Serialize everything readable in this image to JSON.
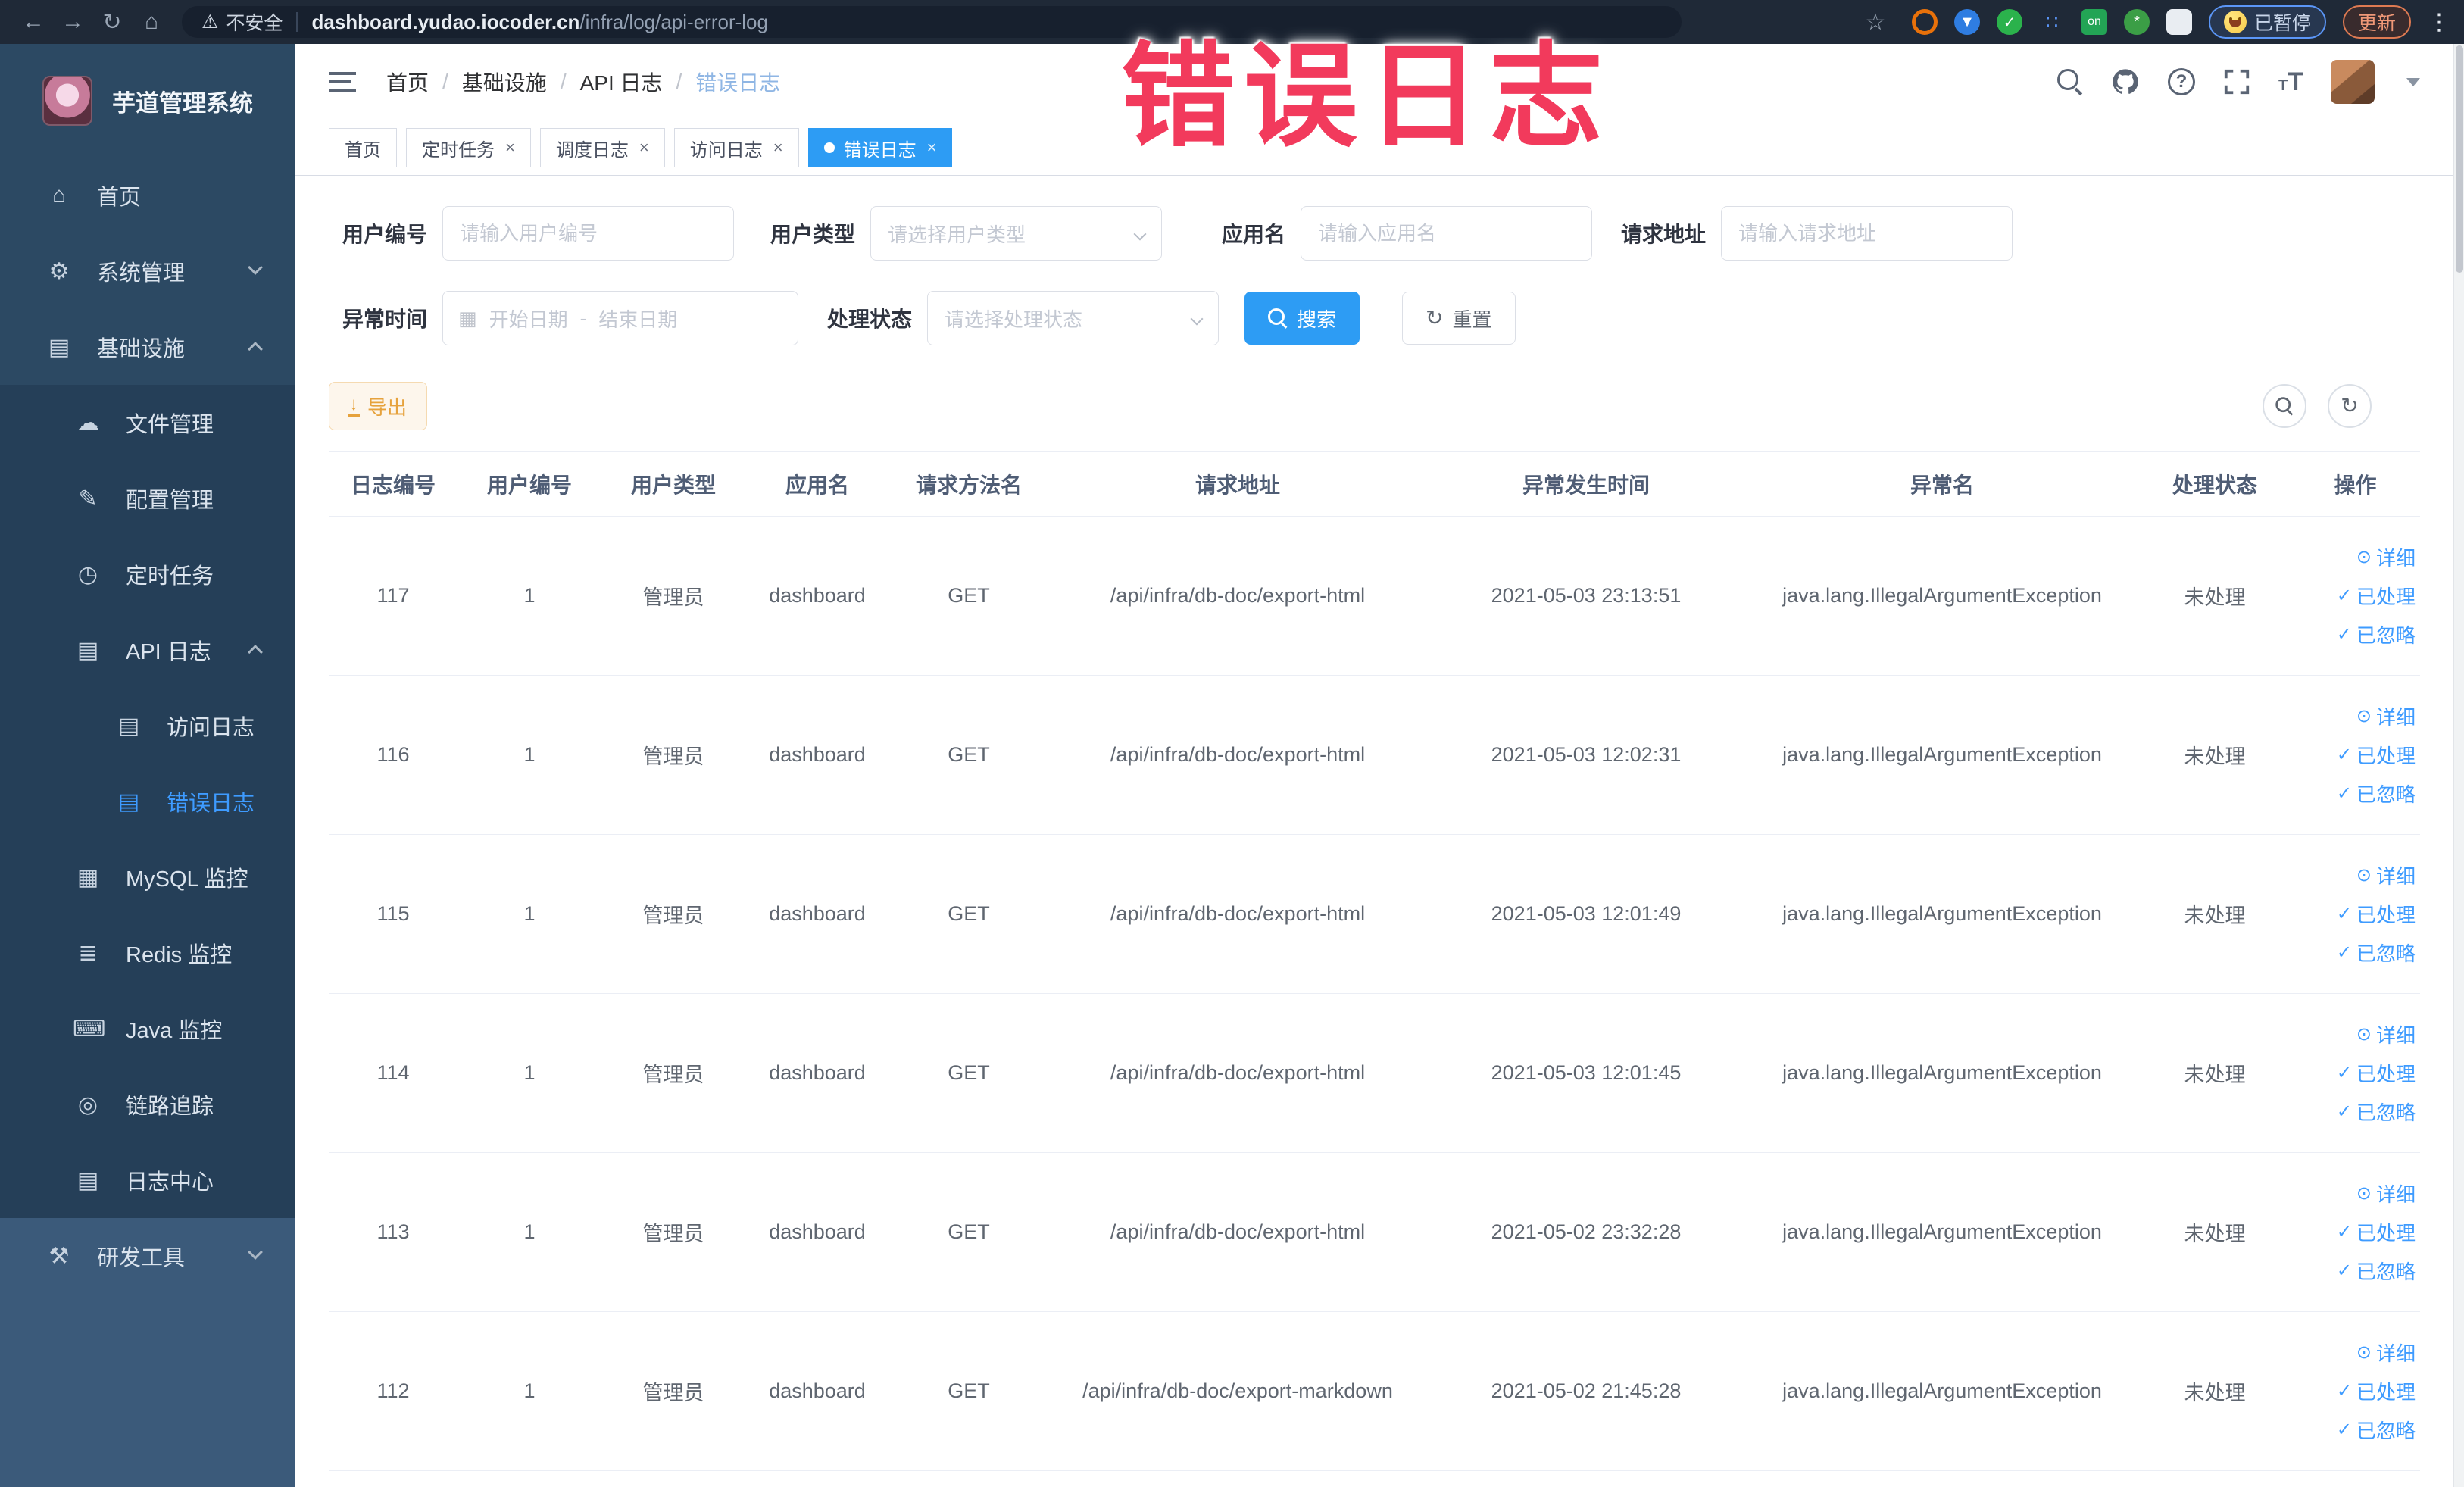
{
  "overlay": {
    "text": "错误日志",
    "color": "#f23a5c"
  },
  "browser": {
    "security_label": "不安全",
    "url_host": "dashboard.yudao.iocoder.cn",
    "url_path": "/infra/log/api-error-log",
    "on_badge": "on",
    "paused_label": "已暂停",
    "update_label": "更新"
  },
  "sidebar": {
    "logo_title": "芋道管理系统",
    "items": [
      {
        "label": "首页"
      },
      {
        "label": "系统管理"
      },
      {
        "label": "基础设施"
      },
      {
        "label": "文件管理"
      },
      {
        "label": "配置管理"
      },
      {
        "label": "定时任务"
      },
      {
        "label": "API 日志"
      },
      {
        "label": "访问日志"
      },
      {
        "label": "错误日志"
      },
      {
        "label": "MySQL 监控"
      },
      {
        "label": "Redis 监控"
      },
      {
        "label": "Java 监控"
      },
      {
        "label": "链路追踪"
      },
      {
        "label": "日志中心"
      },
      {
        "label": "研发工具"
      }
    ]
  },
  "header": {
    "breadcrumb": [
      "首页",
      "基础设施",
      "API 日志",
      "错误日志"
    ],
    "help_glyph": "?"
  },
  "tabs": [
    {
      "label": "首页"
    },
    {
      "label": "定时任务"
    },
    {
      "label": "调度日志"
    },
    {
      "label": "访问日志"
    },
    {
      "label": "错误日志"
    }
  ],
  "filters": {
    "user_id_label": "用户编号",
    "user_id_placeholder": "请输入用户编号",
    "user_type_label": "用户类型",
    "user_type_placeholder": "请选择用户类型",
    "app_name_label": "应用名",
    "app_name_placeholder": "请输入应用名",
    "request_url_label": "请求地址",
    "request_url_placeholder": "请输入请求地址",
    "exception_time_label": "异常时间",
    "start_date_placeholder": "开始日期",
    "range_separator": "-",
    "end_date_placeholder": "结束日期",
    "process_status_label": "处理状态",
    "process_status_placeholder": "请选择处理状态",
    "search_label": "搜索",
    "reset_label": "重置"
  },
  "toolbar": {
    "export_label": "导出"
  },
  "table": {
    "columns": [
      "日志编号",
      "用户编号",
      "用户类型",
      "应用名",
      "请求方法名",
      "请求地址",
      "异常发生时间",
      "异常名",
      "处理状态",
      "操作"
    ],
    "actions": {
      "detail": "详细",
      "processed": "已处理",
      "ignored": "已忽略"
    },
    "rows": [
      {
        "id": "117",
        "user_id": "1",
        "user_type": "管理员",
        "app": "dashboard",
        "method": "GET",
        "url": "/api/infra/db-doc/export-html",
        "time": "2021-05-03 23:13:51",
        "exception": "java.lang.IllegalArgumentException",
        "status": "未处理"
      },
      {
        "id": "116",
        "user_id": "1",
        "user_type": "管理员",
        "app": "dashboard",
        "method": "GET",
        "url": "/api/infra/db-doc/export-html",
        "time": "2021-05-03 12:02:31",
        "exception": "java.lang.IllegalArgumentException",
        "status": "未处理"
      },
      {
        "id": "115",
        "user_id": "1",
        "user_type": "管理员",
        "app": "dashboard",
        "method": "GET",
        "url": "/api/infra/db-doc/export-html",
        "time": "2021-05-03 12:01:49",
        "exception": "java.lang.IllegalArgumentException",
        "status": "未处理"
      },
      {
        "id": "114",
        "user_id": "1",
        "user_type": "管理员",
        "app": "dashboard",
        "method": "GET",
        "url": "/api/infra/db-doc/export-html",
        "time": "2021-05-03 12:01:45",
        "exception": "java.lang.IllegalArgumentException",
        "status": "未处理"
      },
      {
        "id": "113",
        "user_id": "1",
        "user_type": "管理员",
        "app": "dashboard",
        "method": "GET",
        "url": "/api/infra/db-doc/export-html",
        "time": "2021-05-02 23:32:28",
        "exception": "java.lang.IllegalArgumentException",
        "status": "未处理"
      },
      {
        "id": "112",
        "user_id": "1",
        "user_type": "管理员",
        "app": "dashboard",
        "method": "GET",
        "url": "/api/infra/db-doc/export-markdown",
        "time": "2021-05-02 21:45:28",
        "exception": "java.lang.IllegalArgumentException",
        "status": "未处理"
      }
    ]
  },
  "colors": {
    "accent_blue": "#2d9cf4",
    "link_blue": "#3e9bff",
    "warning_orange": "#e6a23c",
    "sidebar_bg": "#2c4963",
    "sidebar_submenu_bg": "#253f58",
    "browser_bar_bg": "#1f2937",
    "overlay_red": "#f23a5c"
  }
}
